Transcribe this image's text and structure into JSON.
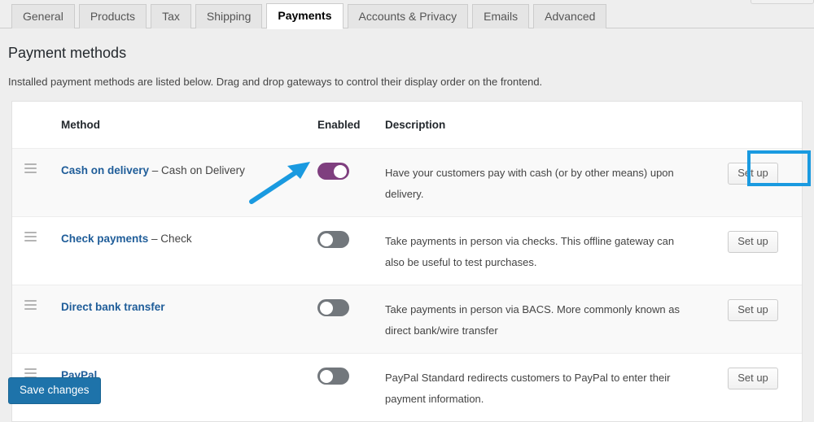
{
  "tabs": [
    {
      "label": "General",
      "active": false
    },
    {
      "label": "Products",
      "active": false
    },
    {
      "label": "Tax",
      "active": false
    },
    {
      "label": "Shipping",
      "active": false
    },
    {
      "label": "Payments",
      "active": true
    },
    {
      "label": "Accounts & Privacy",
      "active": false
    },
    {
      "label": "Emails",
      "active": false
    },
    {
      "label": "Advanced",
      "active": false
    }
  ],
  "page": {
    "title": "Payment methods",
    "subtitle": "Installed payment methods are listed below. Drag and drop gateways to control their display order on the frontend."
  },
  "table": {
    "headers": {
      "method": "Method",
      "enabled": "Enabled",
      "description": "Description"
    },
    "rows": [
      {
        "sort_icon": "drag-handle-icon",
        "name": "Cash on delivery",
        "suffix": " – Cash on Delivery",
        "enabled": true,
        "toggle_state": "on",
        "description": "Have your customers pay with cash (or by other means) upon delivery.",
        "action_label": "Set up",
        "highlighted": true
      },
      {
        "sort_icon": "drag-handle-icon",
        "name": "Check payments",
        "suffix": " – Check",
        "enabled": false,
        "toggle_state": "off",
        "description": "Take payments in person via checks. This offline gateway can also be useful to test purchases.",
        "action_label": "Set up",
        "highlighted": false
      },
      {
        "sort_icon": "drag-handle-icon",
        "name": "Direct bank transfer",
        "suffix": "",
        "enabled": false,
        "toggle_state": "off",
        "description": "Take payments in person via BACS. More commonly known as direct bank/wire transfer",
        "action_label": "Set up",
        "highlighted": false
      },
      {
        "sort_icon": "drag-handle-icon",
        "name": "PayPal",
        "suffix": "",
        "enabled": false,
        "toggle_state": "off",
        "description": "PayPal Standard redirects customers to PayPal to enter their payment information.",
        "action_label": "Set up",
        "highlighted": false
      }
    ]
  },
  "footer": {
    "save_label": "Save changes"
  },
  "annotations": {
    "arrow": {
      "name": "pointer-arrow",
      "color": "#1a9ae0",
      "points_to": "enabled-toggle-row-1"
    },
    "highlight_box": {
      "name": "focus-highlight",
      "color": "#1a9ae0",
      "around": "setup-button-row-1"
    }
  },
  "colors": {
    "toggle_on": "#7f3f7f",
    "toggle_off": "#72777c",
    "link": "#1f5d99",
    "save_button": "#1e73aa",
    "annotation": "#1a9ae0",
    "page_background": "#eeeeee",
    "row_shade": "#f9f9f9"
  }
}
